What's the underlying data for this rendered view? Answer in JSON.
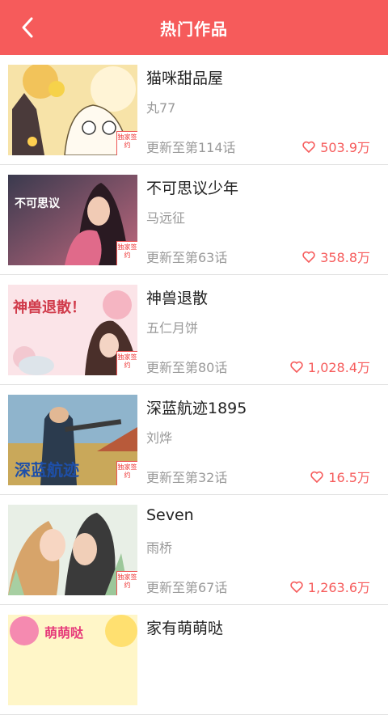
{
  "header": {
    "title": "热门作品",
    "back_icon": "chevron-left-icon",
    "color": "#f65b5b"
  },
  "badge_text": "独家签约",
  "items": [
    {
      "name": "猫咪甜品屋",
      "author": "丸77",
      "update": "更新至第114话",
      "likes": "503.9万",
      "cover_colors": [
        "#f3c66a",
        "#fff4d6"
      ]
    },
    {
      "name": "不可思议少年",
      "author": "马远征",
      "update": "更新至第63话",
      "likes": "358.8万",
      "cover_colors": [
        "#d65a7a",
        "#3a3a5a"
      ],
      "cover_text": "不可思议"
    },
    {
      "name": "神兽退散",
      "author": "五仁月饼",
      "update": "更新至第80话",
      "likes": "1,028.4万",
      "cover_colors": [
        "#f6c7cf",
        "#fde9ec"
      ],
      "cover_text": "神兽退散！"
    },
    {
      "name": "深蓝航迹1895",
      "author": "刘烨",
      "update": "更新至第32话",
      "likes": "16.5万",
      "cover_colors": [
        "#7aa8c8",
        "#d8c07a"
      ],
      "cover_text": "深蓝航迹"
    },
    {
      "name": "Seven",
      "author": "雨桥",
      "update": "更新至第67话",
      "likes": "1,263.6万",
      "cover_colors": [
        "#cfe3d4",
        "#f2e4d6"
      ]
    },
    {
      "name": "家有萌萌哒",
      "author": "",
      "update": "",
      "likes": "",
      "cover_colors": [
        "#f0d060",
        "#f5a0c0"
      ],
      "cover_text": "萌萌哒"
    }
  ]
}
